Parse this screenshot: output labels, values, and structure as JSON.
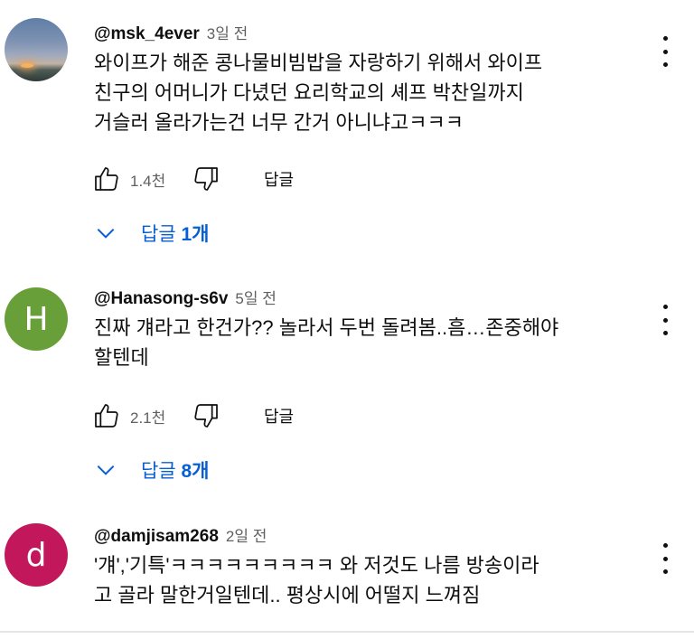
{
  "comments": [
    {
      "author": "@msk_4ever",
      "time": "3일 전",
      "avatar": {
        "type": "photo",
        "letter": "",
        "color": "#6d84a8"
      },
      "lines": [
        "와이프가 해준 콩나물비빔밥을 자랑하기 위해서 와이프",
        "친구의 어머니가 다녔던 요리학교의 셰프 박찬일까지",
        "거슬러 올라가는건 너무 간거 아니냐고ㅋㅋㅋ"
      ],
      "likes": "1.4천",
      "reply_label": "답글",
      "replies_label": "답글",
      "replies_count": "1개"
    },
    {
      "author": "@Hanasong-s6v",
      "time": "5일 전",
      "avatar": {
        "type": "letter",
        "letter": "H",
        "color": "#689f38"
      },
      "lines": [
        "진짜 걔라고 한건가?? 놀라서 두번 돌려봄..흠…존중해야",
        "할텐데"
      ],
      "likes": "2.1천",
      "reply_label": "답글",
      "replies_label": "답글",
      "replies_count": "8개"
    },
    {
      "author": "@damjisam268",
      "time": "2일 전",
      "avatar": {
        "type": "letter",
        "letter": "d",
        "color": "#c2185b"
      },
      "lines": [
        "'걔','기특'ㅋㅋㅋㅋㅋㅋㅋㅋㅋ 와 저것도 나름 방송이라",
        "고 골라 말한거일텐데.. 평상시에 어떨지 느껴짐"
      ]
    }
  ],
  "icons": {
    "like": "thumb-up-icon",
    "dislike": "thumb-down-icon",
    "menu": "more-vert-icon",
    "expand": "chevron-down-icon"
  },
  "colors": {
    "link": "#065fd4",
    "secondary_text": "#606060"
  }
}
